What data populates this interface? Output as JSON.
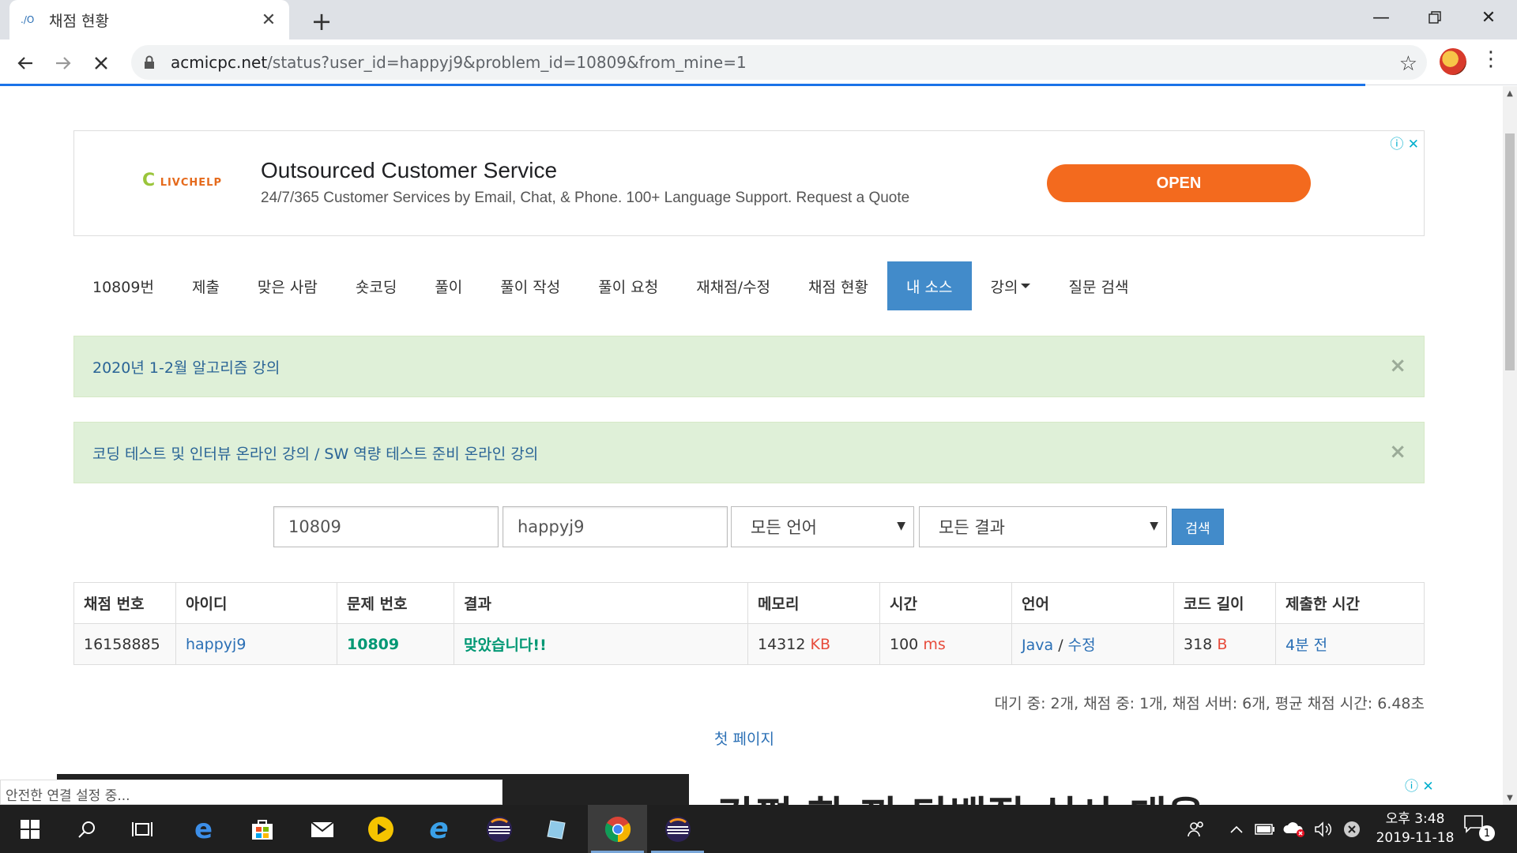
{
  "browser": {
    "tab_title": "채점 현황",
    "tab_favicon": "./O",
    "new_tab": "+",
    "url_host": "acmicpc.net",
    "url_path": "/status?user_id=happyj9&problem_id=10809&from_mine=1",
    "status_text": "안전한 연결 설정 중..."
  },
  "ad_top": {
    "logo": "LIVCHELP",
    "headline": "Outsourced Customer Service",
    "description": "24/7/365 Customer Services by Email, Chat, & Phone. 100+ Language Support. Request a Quote",
    "button": "OPEN"
  },
  "nav": {
    "items": [
      {
        "label": "10809번"
      },
      {
        "label": "제출"
      },
      {
        "label": "맞은 사람"
      },
      {
        "label": "숏코딩"
      },
      {
        "label": "풀이"
      },
      {
        "label": "풀이 작성"
      },
      {
        "label": "풀이 요청"
      },
      {
        "label": "재채점/수정"
      },
      {
        "label": "채점 현황"
      },
      {
        "label": "내 소스"
      },
      {
        "label": "강의"
      },
      {
        "label": "질문 검색"
      }
    ]
  },
  "alerts": [
    {
      "text": "2020년 1-2월 알고리즘 강의",
      "close": "×"
    },
    {
      "text": "코딩 테스트 및 인터뷰 온라인 강의 / SW 역량 테스트 준비 온라인 강의",
      "close": "×"
    }
  ],
  "search": {
    "problem_id": "10809",
    "user_id": "happyj9",
    "language": "모든 언어",
    "result": "모든 결과",
    "button": "검색"
  },
  "table": {
    "headers": [
      "채점 번호",
      "아이디",
      "문제 번호",
      "결과",
      "메모리",
      "시간",
      "언어",
      "코드 길이",
      "제출한 시간"
    ],
    "rows": [
      {
        "submission_id": "16158885",
        "user": "happyj9",
        "problem": "10809",
        "result": "맞았습니다!!",
        "memory": "14312",
        "memory_unit": "KB",
        "time": "100",
        "time_unit": "ms",
        "language": "Java",
        "language_sep": "/",
        "edit": "수정",
        "code_length": "318",
        "code_unit": "B",
        "submitted": "4분 전"
      }
    ]
  },
  "queue_info": "대기 중: 2개, 채점 중: 1개, 채점 서버: 6개, 평균 채점 시간: 6.48초",
  "first_page": "첫 페이지",
  "ad_bottom": {
    "text": "간편 한 끼 단백질 식사 대용"
  },
  "taskbar": {
    "clock_time": "오후 3:48",
    "clock_date": "2019-11-18",
    "notification_count": "1"
  },
  "colors": {
    "primary": "#428bca",
    "alert_bg": "#dff0d8",
    "accepted": "#009874",
    "unit": "#e74c3c",
    "ad_button": "#f36a1e"
  }
}
